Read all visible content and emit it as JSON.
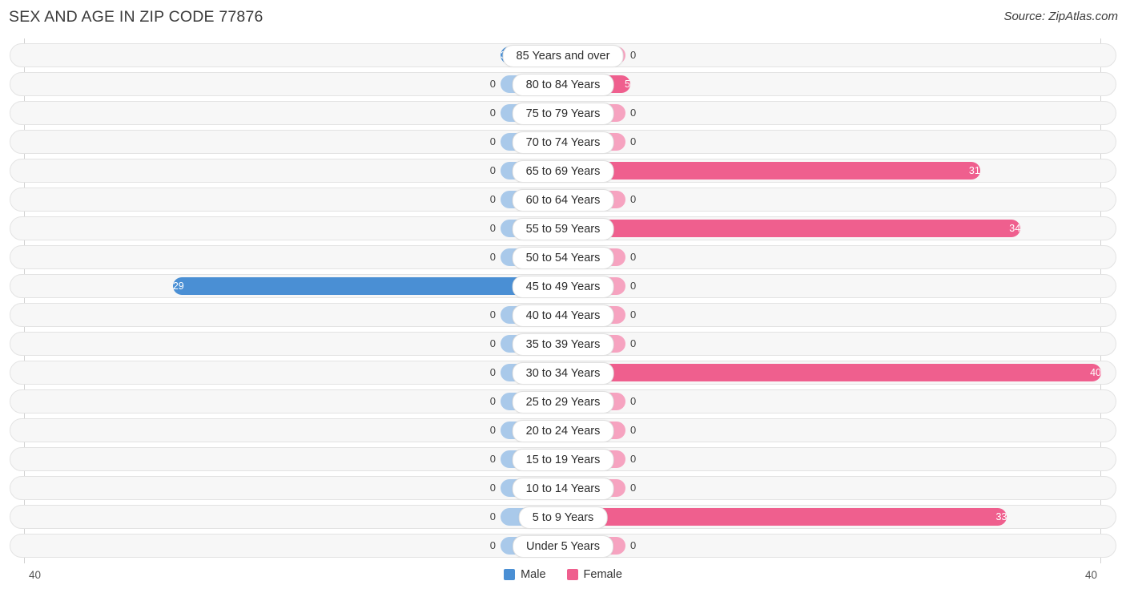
{
  "header": {
    "title": "SEX AND AGE IN ZIP CODE 77876",
    "source": "Source: ZipAtlas.com"
  },
  "footer": {
    "axis_left": "40",
    "axis_right": "40",
    "legend": [
      {
        "label": "Male",
        "color": "#4a8fd4"
      },
      {
        "label": "Female",
        "color": "#ef5f8e"
      }
    ]
  },
  "chart_data": {
    "type": "bar",
    "title": "SEX AND AGE IN ZIP CODE 77876",
    "subtitle": "Source: ZipAtlas.com",
    "orientation": "horizontal",
    "layout": "population-pyramid",
    "xlabel": "",
    "ylabel": "",
    "xlim": [
      0,
      40
    ],
    "axis_max": 40,
    "grid": false,
    "legend_position": "bottom-center",
    "categories": [
      "85 Years and over",
      "80 to 84 Years",
      "75 to 79 Years",
      "70 to 74 Years",
      "65 to 69 Years",
      "60 to 64 Years",
      "55 to 59 Years",
      "50 to 54 Years",
      "45 to 49 Years",
      "40 to 44 Years",
      "35 to 39 Years",
      "30 to 34 Years",
      "25 to 29 Years",
      "20 to 24 Years",
      "15 to 19 Years",
      "10 to 14 Years",
      "5 to 9 Years",
      "Under 5 Years"
    ],
    "series": [
      {
        "name": "Male",
        "color": "#4a8fd4",
        "values": [
          3,
          0,
          0,
          0,
          0,
          0,
          0,
          0,
          29,
          0,
          0,
          0,
          0,
          0,
          0,
          0,
          0,
          0
        ]
      },
      {
        "name": "Female",
        "color": "#ef5f8e",
        "values": [
          0,
          5,
          0,
          0,
          31,
          0,
          34,
          0,
          0,
          0,
          0,
          40,
          0,
          0,
          0,
          0,
          33,
          0
        ]
      }
    ]
  }
}
